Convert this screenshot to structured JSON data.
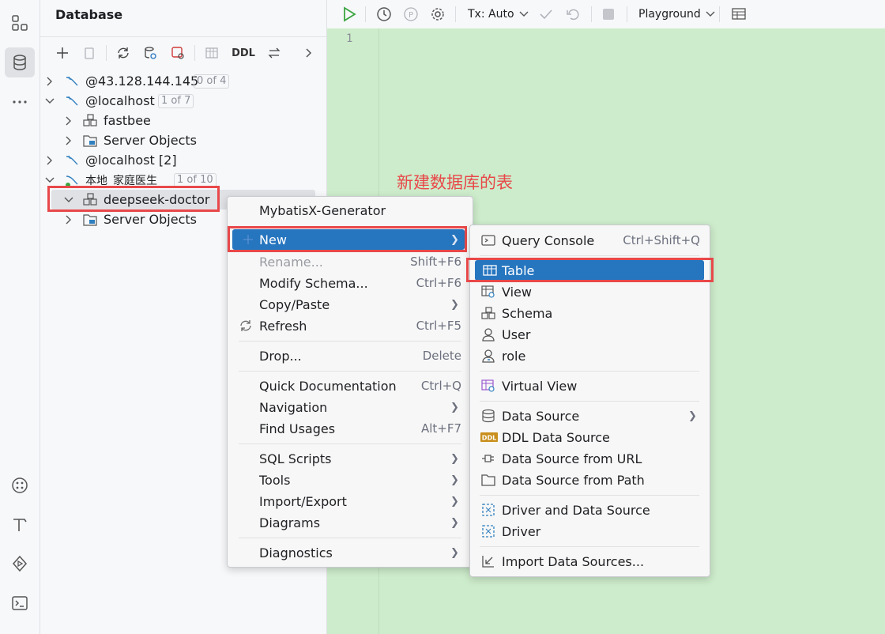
{
  "left_strip": {
    "icons": [
      "structure-icon",
      "database-icon",
      "more-icon"
    ],
    "bottom_icons": [
      "services-icon",
      "build-icon",
      "run-icon",
      "terminal-icon"
    ]
  },
  "db_panel": {
    "title": "Database",
    "toolbar": {
      "ddl_label": "DDL"
    },
    "tree": [
      {
        "label": "@43.128.144.145",
        "badge": "0 of 4"
      },
      {
        "label": "@localhost",
        "badge": "1 of 7"
      },
      {
        "label": "fastbee"
      },
      {
        "label": "Server Objects"
      },
      {
        "label": "@localhost [2]"
      },
      {
        "label": "本地_家庭医生",
        "badge": "1 of 10"
      },
      {
        "label": "deepseek-doctor"
      },
      {
        "label": "Server Objects"
      }
    ]
  },
  "editor": {
    "toolbar": {
      "tx_label": "Tx: Auto",
      "playground_label": "Playground"
    },
    "line_number": "1"
  },
  "annotation": "新建数据库的表",
  "context_menu": {
    "items": [
      {
        "label": "MybatisX-Generator",
        "shortcut": ""
      },
      {
        "label": "New",
        "shortcut": ""
      },
      {
        "label": "Rename...",
        "shortcut": "Shift+F6"
      },
      {
        "label": "Modify Schema...",
        "shortcut": "Ctrl+F6"
      },
      {
        "label": "Copy/Paste",
        "shortcut": ""
      },
      {
        "label": "Refresh",
        "shortcut": "Ctrl+F5"
      },
      {
        "label": "Drop...",
        "shortcut": "Delete"
      },
      {
        "label": "Quick Documentation",
        "shortcut": "Ctrl+Q"
      },
      {
        "label": "Navigation",
        "shortcut": ""
      },
      {
        "label": "Find Usages",
        "shortcut": "Alt+F7"
      },
      {
        "label": "SQL Scripts",
        "shortcut": ""
      },
      {
        "label": "Tools",
        "shortcut": ""
      },
      {
        "label": "Import/Export",
        "shortcut": ""
      },
      {
        "label": "Diagrams",
        "shortcut": ""
      },
      {
        "label": "Diagnostics",
        "shortcut": ""
      }
    ]
  },
  "submenu": {
    "items": [
      {
        "label": "Query Console",
        "shortcut": "Ctrl+Shift+Q"
      },
      {
        "label": "Table"
      },
      {
        "label": "View"
      },
      {
        "label": "Schema"
      },
      {
        "label": "User"
      },
      {
        "label": "role"
      },
      {
        "label": "Virtual View"
      },
      {
        "label": "Data Source"
      },
      {
        "label": "DDL Data Source"
      },
      {
        "label": "Data Source from URL"
      },
      {
        "label": "Data Source from Path"
      },
      {
        "label": "Driver and Data Source"
      },
      {
        "label": "Driver"
      },
      {
        "label": "Import Data Sources..."
      }
    ]
  },
  "colors": {
    "highlight": "#2675bf",
    "annotation_red": "#e8484a",
    "editor_bg": "#cdeccb"
  }
}
